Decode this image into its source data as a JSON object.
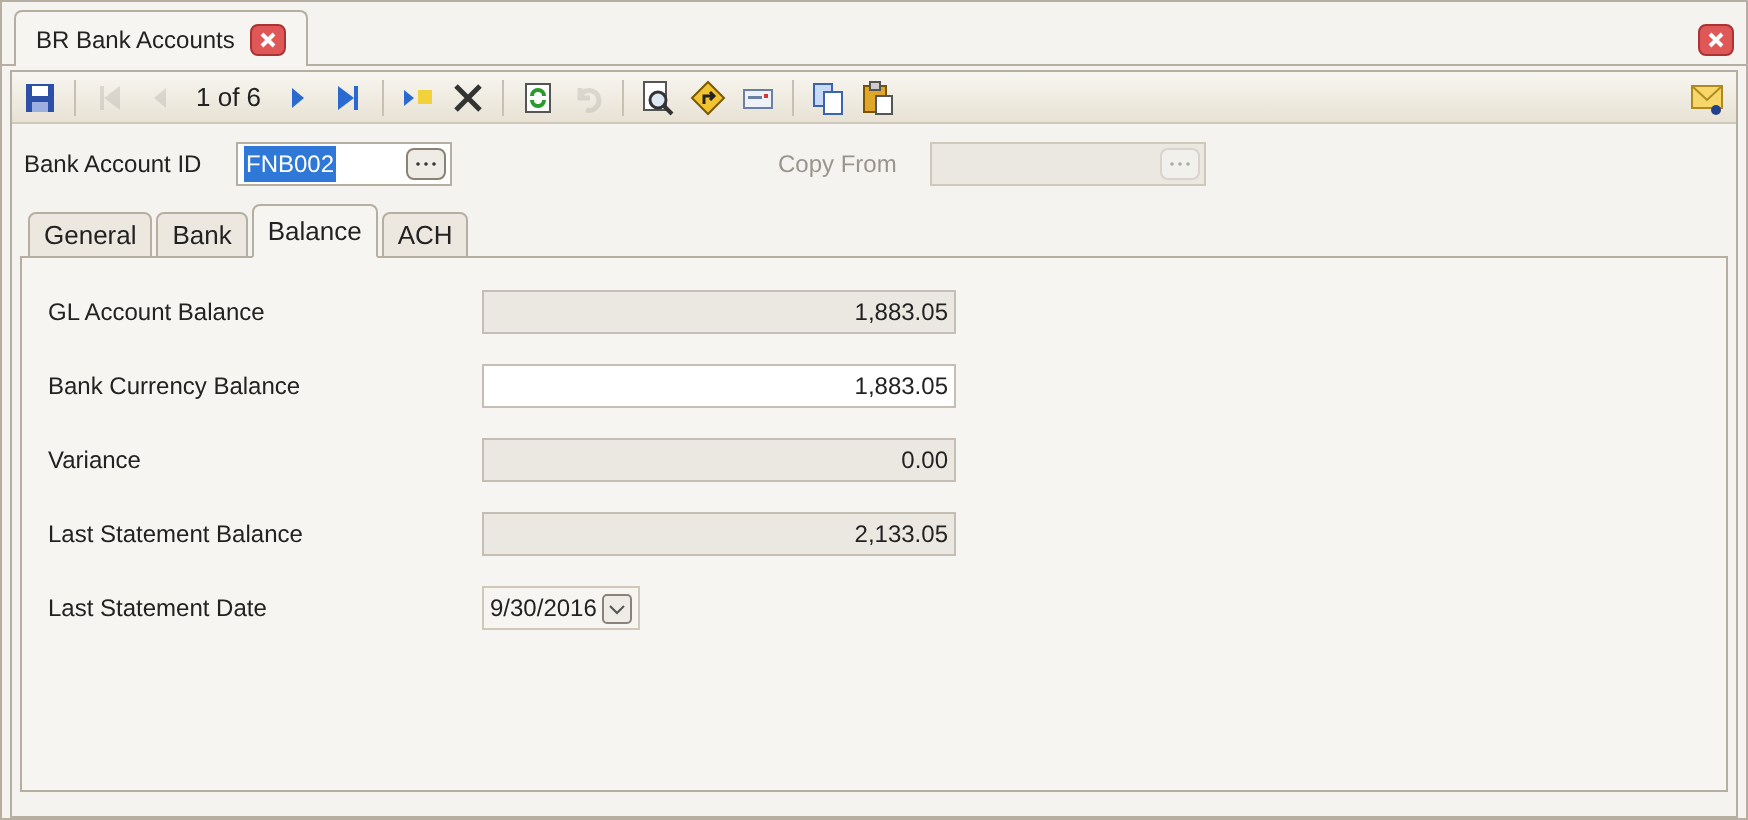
{
  "document_tab": {
    "title": "BR Bank Accounts"
  },
  "toolbar": {
    "record_position": "1 of 6",
    "buttons": [
      {
        "disabled": false
      },
      {
        "disabled": true
      },
      {
        "disabled": true
      },
      {
        "disabled": false
      },
      {
        "disabled": false
      },
      {
        "disabled": false
      },
      {
        "disabled": false
      },
      {
        "disabled": false
      },
      {
        "disabled": true
      },
      {
        "disabled": false
      },
      {
        "disabled": false
      },
      {
        "disabled": false
      },
      {
        "disabled": false
      },
      {
        "disabled": false
      },
      {
        "disabled": false
      }
    ]
  },
  "header": {
    "bank_account_id": {
      "label": "Bank Account ID",
      "value": "FNB002",
      "disabled": false
    },
    "copy_from": {
      "label": "Copy From",
      "disabled": true
    }
  },
  "tabs": [
    {
      "label": "General",
      "selected": false
    },
    {
      "label": "Bank",
      "selected": false
    },
    {
      "label": "Balance",
      "selected": true
    },
    {
      "label": "ACH",
      "selected": false
    }
  ],
  "fields": [
    {
      "label": "GL Account Balance",
      "value": "1,883.05",
      "kind": "number",
      "disabled": true
    },
    {
      "label": "Bank Currency Balance",
      "value": "1,883.05",
      "kind": "number",
      "disabled": false
    },
    {
      "label": "Variance",
      "value": "0.00",
      "kind": "number",
      "disabled": true
    },
    {
      "label": "Last Statement Balance",
      "value": "2,133.05",
      "kind": "number",
      "disabled": true
    },
    {
      "label": "Last Statement Date",
      "value": "9/30/2016",
      "kind": "date",
      "disabled": false
    }
  ]
}
